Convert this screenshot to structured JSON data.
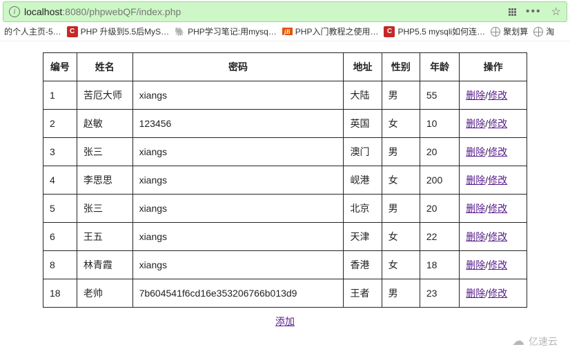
{
  "address_bar": {
    "url_prefix": "localhost",
    "url_port_path": ":8080/phpwebQF/index.php"
  },
  "bookmarks": {
    "items": [
      {
        "label": "的个人主页-5…",
        "icon": "none"
      },
      {
        "label": "PHP 升级到5.5后MyS…",
        "icon": "red-c"
      },
      {
        "label": "PHP学习笔记:用mysq…",
        "icon": "green-php"
      },
      {
        "label": "PHP入门教程之使用…",
        "icon": "orange-jb"
      },
      {
        "label": "PHP5.5 mysqli如何连…",
        "icon": "red-c"
      },
      {
        "label": "聚划算",
        "icon": "globe"
      },
      {
        "label": "淘",
        "icon": "globe"
      }
    ]
  },
  "table": {
    "headers": {
      "id": "编号",
      "name": "姓名",
      "password": "密码",
      "address": "地址",
      "gender": "性别",
      "age": "年龄",
      "actions": "操作"
    },
    "action_labels": {
      "delete": "删除",
      "edit": "修改",
      "separator": "/"
    },
    "rows": [
      {
        "id": "1",
        "name": "苦厄大师",
        "password": "xiangs",
        "address": "大陆",
        "gender": "男",
        "age": "55"
      },
      {
        "id": "2",
        "name": "赵敏",
        "password": "123456",
        "address": "英国",
        "gender": "女",
        "age": "10"
      },
      {
        "id": "3",
        "name": "张三",
        "password": "xiangs",
        "address": "澳门",
        "gender": "男",
        "age": "20"
      },
      {
        "id": "4",
        "name": "李思思",
        "password": "xiangs",
        "address": "岘港",
        "gender": "女",
        "age": "200"
      },
      {
        "id": "5",
        "name": "张三",
        "password": "xiangs",
        "address": "北京",
        "gender": "男",
        "age": "20"
      },
      {
        "id": "6",
        "name": "王五",
        "password": "xiangs",
        "address": "天津",
        "gender": "女",
        "age": "22"
      },
      {
        "id": "8",
        "name": "林青霞",
        "password": "xiangs",
        "address": "香港",
        "gender": "女",
        "age": "18"
      },
      {
        "id": "18",
        "name": "老帅",
        "password": "7b604541f6cd16e353206766b013d9",
        "address": "王者",
        "gender": "男",
        "age": "23"
      }
    ],
    "add_label": "添加"
  },
  "watermark": {
    "text": "亿速云"
  }
}
